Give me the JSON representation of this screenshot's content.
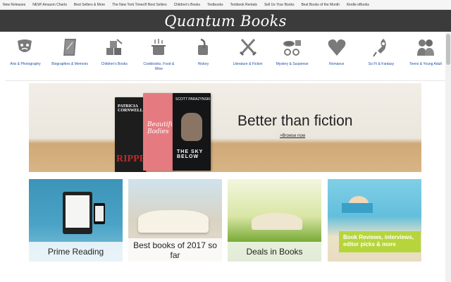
{
  "topnav": {
    "links": [
      "New Releases",
      "NEW! Amazon Charts",
      "Best Sellers & More",
      "The New York Times® Best Sellers",
      "Children's Books",
      "Textbooks",
      "Textbook Rentals",
      "Sell Us Your Books",
      "Best Books of the Month",
      "Kindle eBooks"
    ]
  },
  "header": {
    "logo": "Quantum Books",
    "bg": "#3b3b3b"
  },
  "categories": [
    {
      "label": "Arts & Photography",
      "icon": "theater-masks-icon"
    },
    {
      "label": "Biographies & Memoirs",
      "icon": "book-icon"
    },
    {
      "label": "Children's Books",
      "icon": "toy-blocks-icon"
    },
    {
      "label": "Cookbooks, Food & Wine",
      "icon": "cooking-pot-icon"
    },
    {
      "label": "History",
      "icon": "quill-scroll-icon"
    },
    {
      "label": "Literature & Fiction",
      "icon": "crossed-swords-icon"
    },
    {
      "label": "Mystery & Suspense",
      "icon": "detective-handcuffs-icon"
    },
    {
      "label": "Romance",
      "icon": "heart-icon"
    },
    {
      "label": "Sci Fi & Fantasy",
      "icon": "rocket-icon"
    },
    {
      "label": "Teens & Young Adult",
      "icon": "teens-icon"
    }
  ],
  "hero": {
    "headline": "Better than fiction",
    "link": ">Browse now",
    "books": [
      "PATRICIA CORNWELL",
      "RIPPER",
      "Beautiful Bodies",
      "SCOTT PARAZYNSKI",
      "THE SKY BELOW"
    ]
  },
  "tiles": [
    {
      "caption": "Prime Reading"
    },
    {
      "caption": "Best books of 2017 so far"
    },
    {
      "caption": "Deals in Books"
    },
    {
      "caption": "Book Reviews, interviews, editor picks & more"
    }
  ],
  "colors": {
    "link": "#1f4fa8",
    "icon": "#7a7a7a"
  }
}
